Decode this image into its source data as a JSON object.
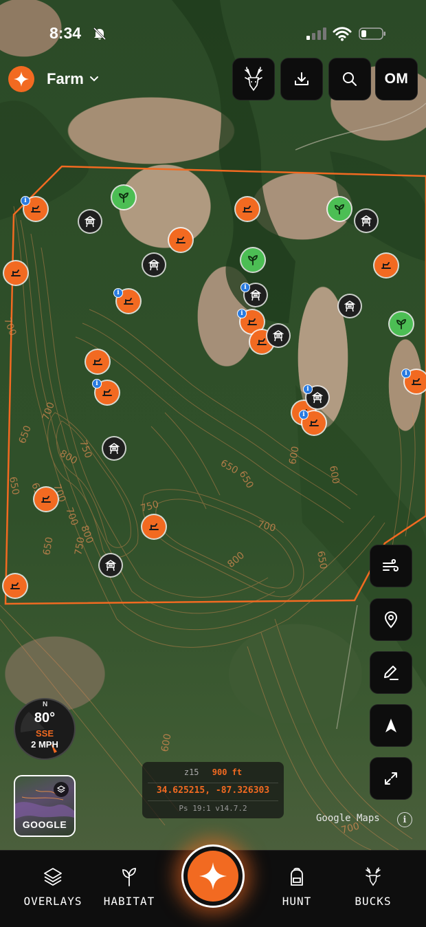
{
  "status_bar": {
    "time": "8:34",
    "icons": [
      "bell-slash-icon",
      "cellular-signal-icon",
      "wifi-icon",
      "battery-icon"
    ]
  },
  "header": {
    "property_name": "Farm",
    "profile_initials": "OM",
    "buttons": [
      "bucks-icon",
      "download-icon",
      "search-icon"
    ]
  },
  "map": {
    "contour_labels": [
      "700",
      "700",
      "750",
      "650",
      "800",
      "650",
      "700",
      "750",
      "650",
      "650",
      "700",
      "650",
      "800",
      "750",
      "800",
      "700",
      "650",
      "600",
      "600",
      "700",
      "650",
      "600"
    ],
    "attribution": "Google Maps"
  },
  "wind": {
    "north": "N",
    "temperature": "80°",
    "direction": "SSE",
    "speed": "2 MPH"
  },
  "layer": {
    "label": "GOOGLE"
  },
  "info_panel": {
    "zoom": "z15",
    "scale": "900 ft",
    "coordinates": "34.625215, -87.326303",
    "build": "Ps 19:1  v14.7.2"
  },
  "right_tools": [
    "wind-flow-icon",
    "location-pin-icon",
    "pencil-icon",
    "navigation-arrow-icon",
    "expand-icon"
  ],
  "bottom_nav": {
    "overlays": "OVERLAYS",
    "habitat": "HABITAT",
    "hunt": "HUNT",
    "bucks": "BUCKS"
  },
  "colors": {
    "accent_orange": "#f26a21",
    "habitat_green": "#4cbe54",
    "stand_dark": "#1f1f1f",
    "info_blue": "#2a7be0",
    "boundary": "#f26a21"
  }
}
